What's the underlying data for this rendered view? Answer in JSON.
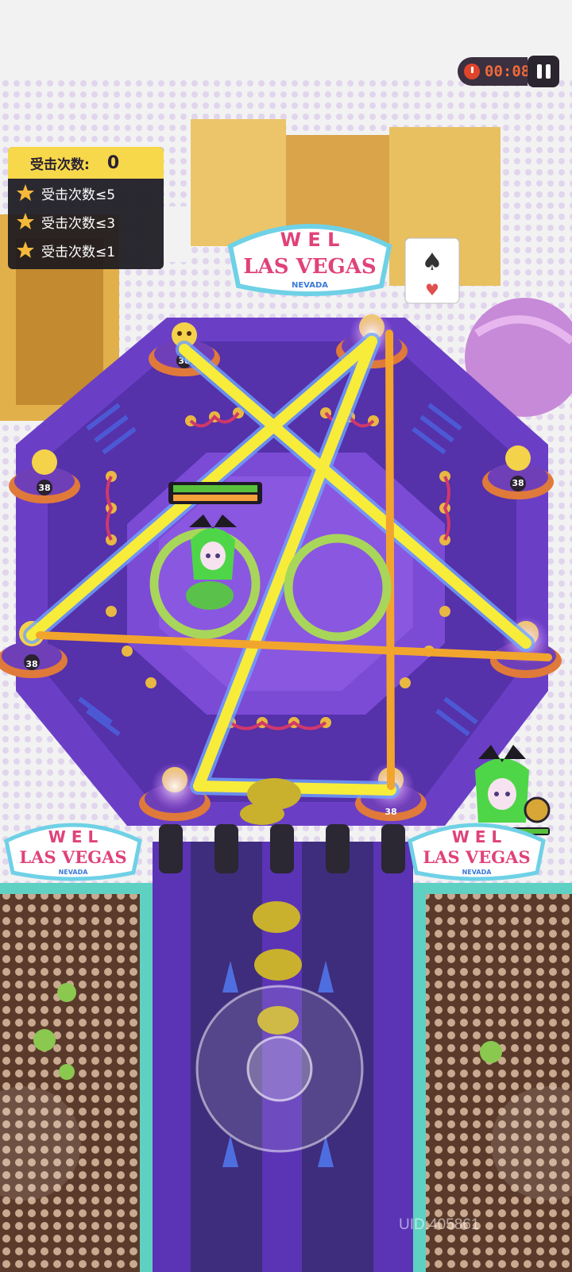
{
  "hud": {
    "timer": "00:08"
  },
  "objectives": {
    "header_label": "受击次数:",
    "hit_count": "0",
    "items": [
      {
        "label": "受击次数≤5"
      },
      {
        "label": "受击次数≤3"
      },
      {
        "label": "受击次数≤1"
      }
    ]
  },
  "signs": {
    "top": {
      "line1": "W E L",
      "line2": "LAS VEGAS",
      "line3": "NEVADA"
    },
    "left": {
      "line1": "W E L",
      "line2": "LAS VEGAS",
      "line3": "NEVADA"
    },
    "right": {
      "line1": "W E L",
      "line2": "LAS VEGAS",
      "line3": "NEVADA"
    }
  },
  "pylon_badge": "38",
  "uid": "UID:405861",
  "colors": {
    "floor": "#6a3fc6",
    "floor_dark": "#3d2a7a",
    "laser": "#f7ec3a",
    "marker_line": "#f2a52d",
    "warning_circle": "#a8d65a",
    "star": "#f4b93a",
    "hp_green": "#58c13c",
    "hp_orange": "#f4a23a"
  }
}
